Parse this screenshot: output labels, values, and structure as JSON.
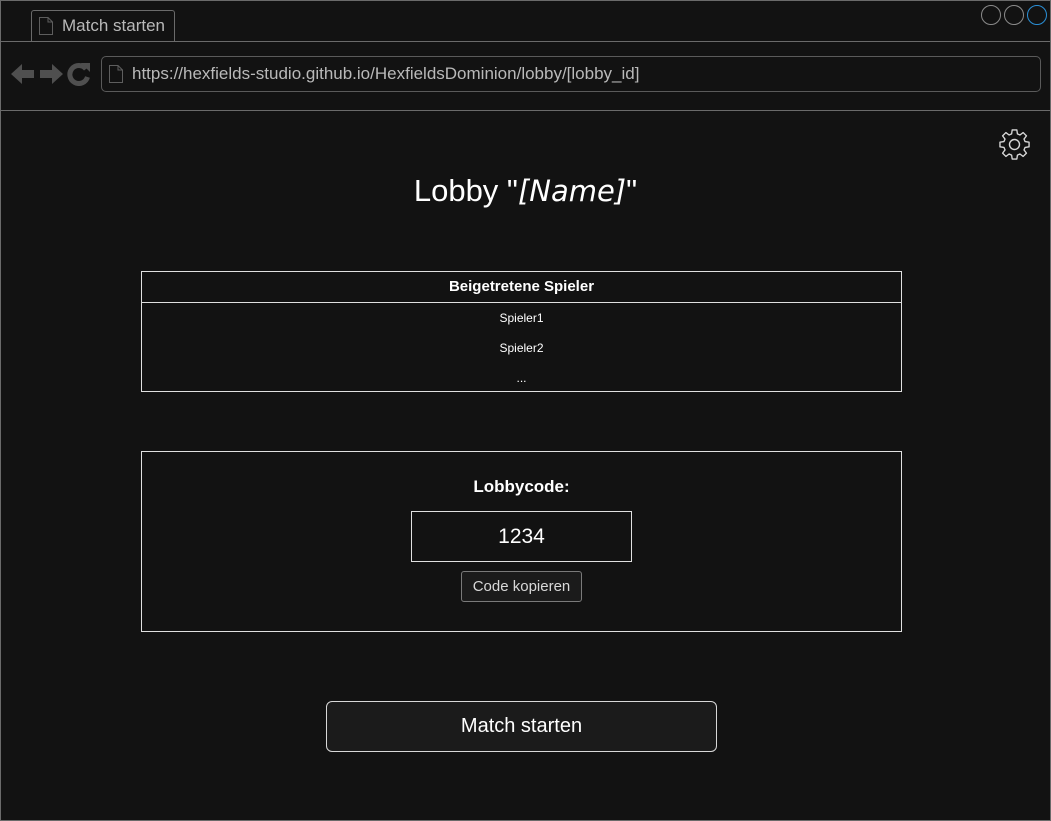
{
  "browser": {
    "tab_title": "Match starten",
    "url": "https://hexfields-studio.github.io/HexfieldsDominion/lobby/[lobby_id]"
  },
  "page": {
    "title_prefix": "Lobby \"",
    "title_name": "[Name]",
    "title_suffix": "\""
  },
  "players_table": {
    "header": "Beigetretene Spieler",
    "rows": [
      "Spieler1",
      "Spieler2",
      "..."
    ]
  },
  "lobby_code": {
    "label": "Lobbycode:",
    "value": "1234",
    "copy_button_label": "Code kopieren"
  },
  "start_button_label": "Match starten",
  "icons": {
    "settings": "gear-icon",
    "back": "back-arrow-icon",
    "forward": "forward-arrow-icon",
    "reload": "reload-icon",
    "page": "page-icon"
  },
  "colors": {
    "background": "#121212",
    "border": "#e0e0e0",
    "window_control_active": "#2a8fd6"
  }
}
